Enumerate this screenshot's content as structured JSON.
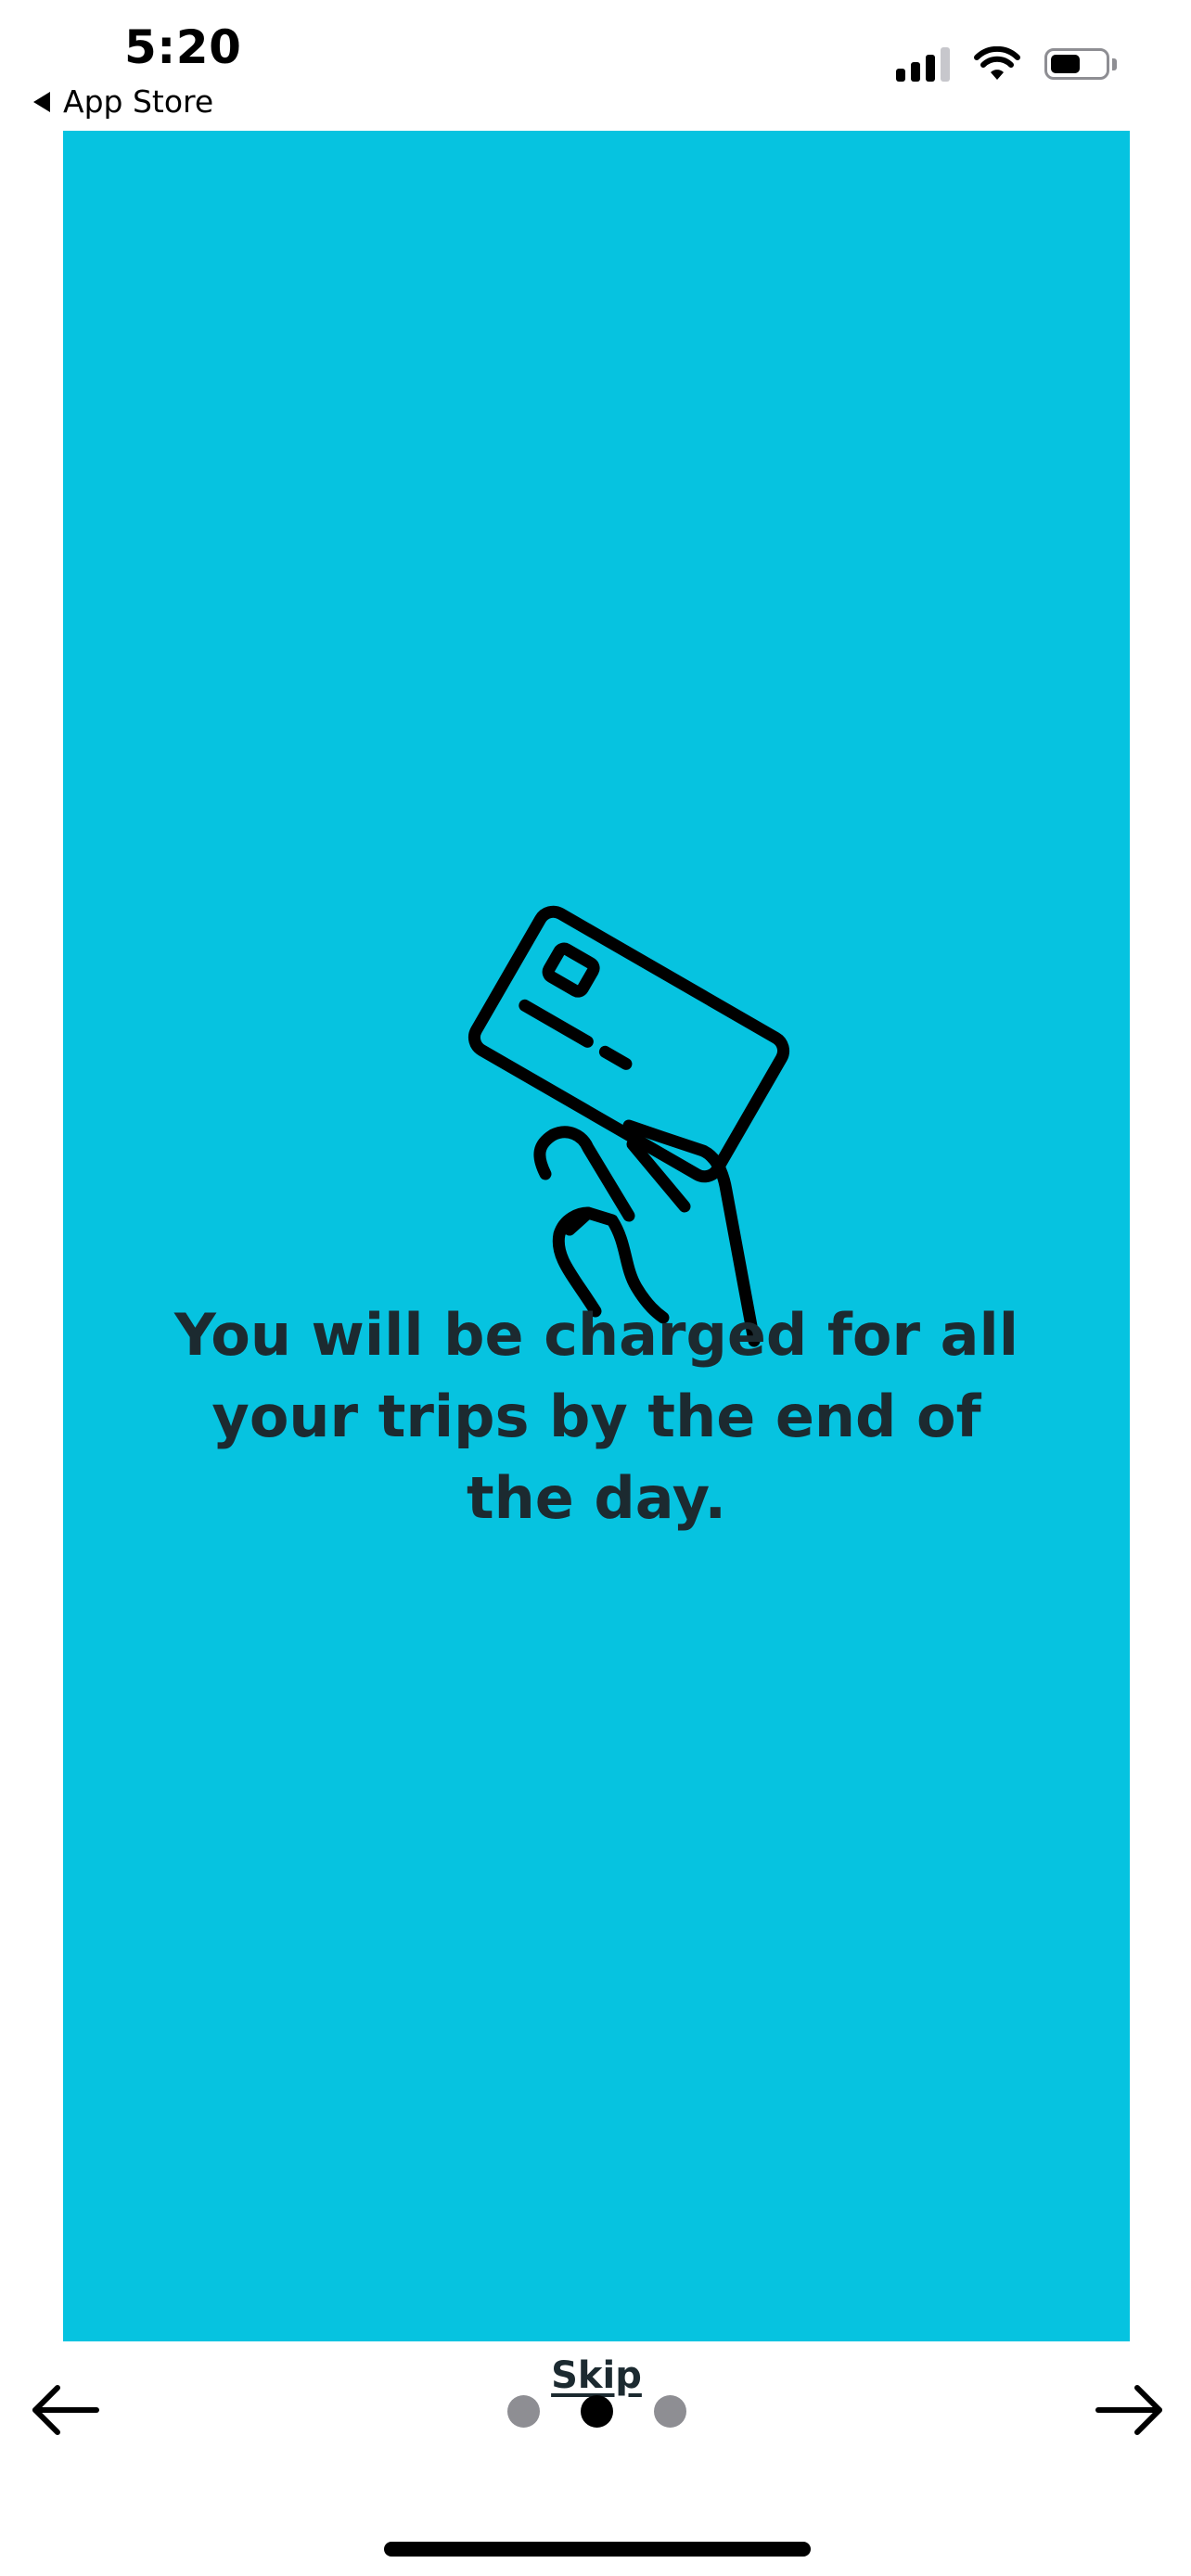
{
  "status_bar": {
    "time": "5:20",
    "back_label": "App Store",
    "icons": [
      "cellular-signal-icon",
      "wifi-icon",
      "battery-icon"
    ],
    "battery_level": 0.55
  },
  "onboarding": {
    "background_color": "#06c3e0",
    "illustration": "hand-holding-credit-card-icon",
    "message": "You will be charged for all your trips by the end of the day.",
    "skip_label": "Skip"
  },
  "pager": {
    "page_count": 3,
    "current_page": 2,
    "prev_icon": "arrow-left-icon",
    "next_icon": "arrow-right-icon"
  }
}
